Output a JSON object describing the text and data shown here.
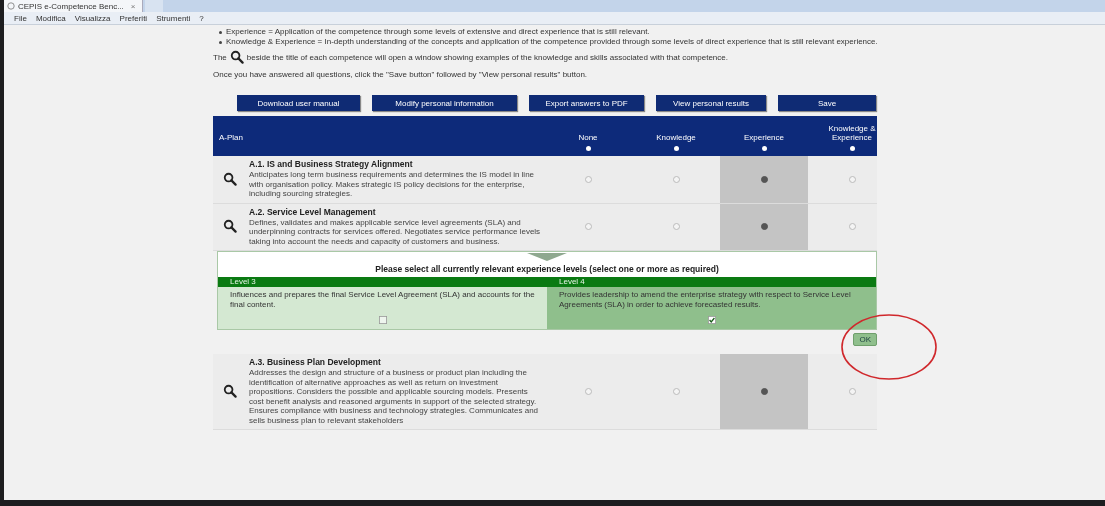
{
  "browser": {
    "tab_title": "CEPIS e-Competence Benc...",
    "tab_close": "×"
  },
  "menu": [
    "File",
    "Modifica",
    "Visualizza",
    "Preferiti",
    "Strumenti",
    "?"
  ],
  "intro": {
    "bullets": [
      "Experience = Application of the competence through some levels of extensive and direct experience that is still relevant.",
      "Knowledge & Experience = In-depth understanding of the concepts and application of the competence provided through some levels of direct experience that is still relevant experience."
    ],
    "magnifier_before": "The",
    "magnifier_after": "beside the title of each competence will open a window showing examples of the knowledge and skills associated with that competence.",
    "instruction": "Once you have answered all questions, click the \"Save button\" followed by \"View personal results\" button."
  },
  "buttons": [
    "Download user manual",
    "Modify personal information",
    "Export answers to PDF",
    "View personal results",
    "Save"
  ],
  "table": {
    "section": "A-Plan",
    "columns": [
      "None",
      "Knowledge",
      "Experience",
      "Knowledge & Experience"
    ],
    "rows": [
      {
        "title": "A.1. IS and Business Strategy Alignment",
        "description": "Anticipates long term business requirements and determines the IS model in line with organisation policy. Makes strategic IS policy decisions for the enterprise, including sourcing strategies.",
        "options": [
          {
            "selected": false
          },
          {
            "selected": false
          },
          {
            "selected": true
          },
          {
            "selected": false
          }
        ]
      },
      {
        "title": "A.2. Service Level Management",
        "description": "Defines, validates and makes applicable service level agreements (SLA) and underpinning contracts for services offered. Negotiates service performance levels taking into account the needs and capacity of customers and business.",
        "options": [
          {
            "selected": false
          },
          {
            "selected": false
          },
          {
            "selected": true
          },
          {
            "selected": false
          }
        ],
        "levels_panel": {
          "prompt": "Please select all currently relevant experience levels (select one or more as required)",
          "levels": [
            {
              "label": "Level 3",
              "description": "Influences and prepares the final Service Level Agreement (SLA) and accounts for the final content.",
              "checked": false
            },
            {
              "label": "Level 4",
              "description": "Provides leadership to amend the enterprise strategy with respect to Service Level Agreements (SLA) in order to achieve forecasted results.",
              "checked": true
            }
          ],
          "ok": "OK"
        }
      },
      {
        "title": "A.3. Business Plan Development",
        "description": "Addresses the design and structure of a business or product plan including the identification of alternative approaches as well as return on investment propositions. Considers the possible and applicable sourcing models. Presents cost benefit analysis and reasoned arguments in support of the selected strategy. Ensures compliance with business and technology strategies. Communicates and sells business plan to relevant stakeholders",
        "options": [
          {
            "selected": false
          },
          {
            "selected": false
          },
          {
            "selected": true
          },
          {
            "selected": false
          }
        ]
      }
    ]
  }
}
